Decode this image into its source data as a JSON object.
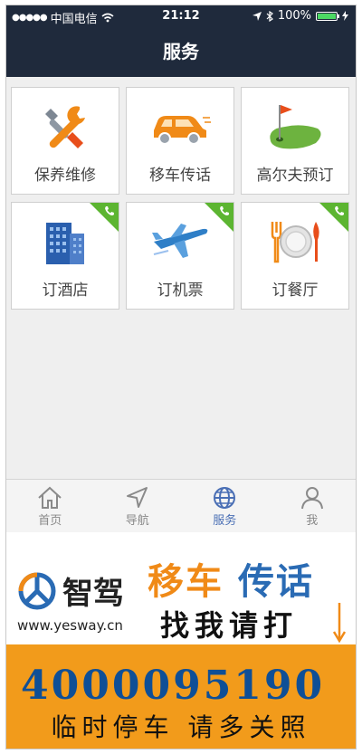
{
  "status_bar": {
    "carrier": "中国电信",
    "time": "21:12",
    "battery": "100%"
  },
  "header": {
    "title": "服务"
  },
  "services": [
    {
      "label": "保养维修",
      "icon": "wrench-screwdriver-icon",
      "phone_badge": false
    },
    {
      "label": "移车传话",
      "icon": "car-icon",
      "phone_badge": false
    },
    {
      "label": "高尔夫预订",
      "icon": "golf-flag-icon",
      "phone_badge": false
    },
    {
      "label": "订酒店",
      "icon": "hotel-building-icon",
      "phone_badge": true
    },
    {
      "label": "订机票",
      "icon": "airplane-icon",
      "phone_badge": true
    },
    {
      "label": "订餐厅",
      "icon": "dining-plate-icon",
      "phone_badge": true
    }
  ],
  "tabbar": {
    "items": [
      {
        "label": "首页",
        "icon": "home-icon",
        "active": false
      },
      {
        "label": "导航",
        "icon": "navigation-arrow-icon",
        "active": false
      },
      {
        "label": "服务",
        "icon": "globe-icon",
        "active": true
      },
      {
        "label": "我",
        "icon": "person-icon",
        "active": false
      }
    ]
  },
  "ad": {
    "brand": "智驾",
    "url": "www.yesway.cn",
    "title_part1": "移车",
    "title_part2": "传话",
    "subtitle": "找我请打",
    "phone": "4000095190",
    "note": "临时停车  请多关照"
  },
  "colors": {
    "header_bg": "#1f2a3c",
    "ribbon": "#5cb531",
    "active_tab": "#4a6fb5",
    "ad_orange": "#f29b1b",
    "ad_blue": "#2a6bb4"
  }
}
